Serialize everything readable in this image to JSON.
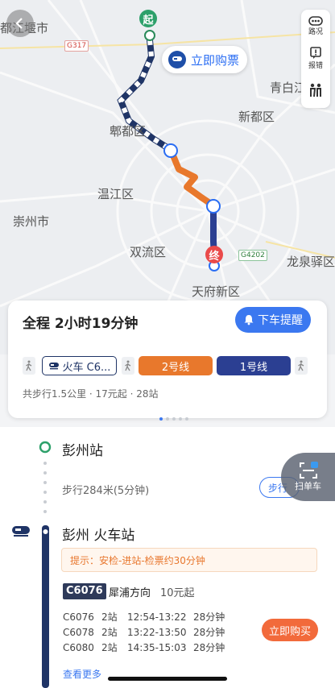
{
  "map": {
    "labels": {
      "top_left_city": "都江堰市",
      "qingbaijiang": "青白江",
      "xindu": "新都区",
      "pidu": "郫都区",
      "wenjiang": "温江区",
      "chongzhou": "崇州市",
      "shuangliu": "双流区",
      "longquanyi": "龙泉驿区",
      "tianfu": "天府新区"
    },
    "road_tags": {
      "g317": "G317",
      "g4202": "G4202"
    },
    "start_pin": "起",
    "end_pin": "终",
    "buy_ticket_bubble": "立即购票",
    "colors": {
      "train": "#1f3466",
      "line2": "#e8782c",
      "line1": "#2b3f92",
      "accent": "#3b78f0"
    }
  },
  "side_tools": [
    {
      "label": "路况",
      "icon": "traffic-icon"
    },
    {
      "label": "报错",
      "icon": "report-icon"
    },
    {
      "label": "",
      "icon": "people-icon"
    }
  ],
  "route_card": {
    "title": "全程  2小时19分钟",
    "alert_button": "下车提醒",
    "segments": {
      "train": "火车 C6...",
      "line2": "2号线",
      "line1": "1号线"
    },
    "summary": "共步行1.5公里 · 17元起 · 28站"
  },
  "detail": {
    "origin_station": "彭州站",
    "walk_text": "步行284米(5分钟)",
    "walk_button": "步行",
    "train_station": "彭州 火车站",
    "tip": "提示：安检-进站-检票约30分钟",
    "train_no": "C6076",
    "train_direction": "犀浦方向",
    "train_price": "10元起",
    "trains": [
      {
        "no": "C6076",
        "stops": "2站",
        "time": "12:54-13:22",
        "duration": "28分钟"
      },
      {
        "no": "C6078",
        "stops": "2站",
        "time": "13:22-13:50",
        "duration": "28分钟"
      },
      {
        "no": "C6080",
        "stops": "2站",
        "time": "14:35-15:03",
        "duration": "28分钟"
      }
    ],
    "buy_now": "立即购买",
    "see_more": "查看更多",
    "scan_label": "扫单车"
  }
}
